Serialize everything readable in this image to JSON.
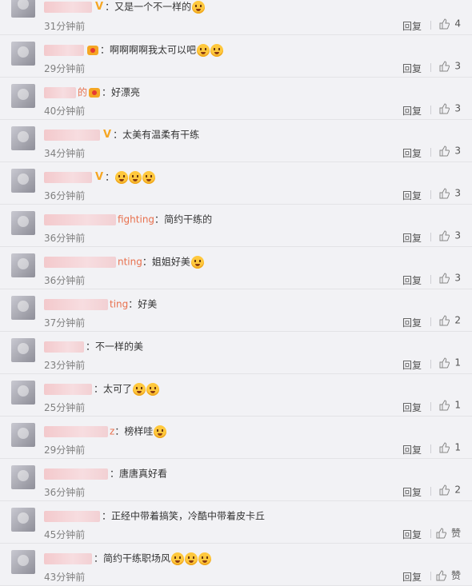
{
  "comments": [
    {
      "user_suffix": "",
      "text": "又是一个不一样的",
      "time": "31分钟前",
      "likes": "4",
      "emoji": 1,
      "badge": "v"
    },
    {
      "user_suffix": "",
      "text": "啊啊啊啊我太可以吧",
      "time": "29分钟前",
      "likes": "3",
      "emoji": 2,
      "badge": "crown"
    },
    {
      "user_suffix": "的",
      "text": "好漂亮",
      "time": "40分钟前",
      "likes": "3",
      "emoji": 0,
      "badge": "crown"
    },
    {
      "user_suffix": "",
      "text": "太美有温柔有干练",
      "time": "34分钟前",
      "likes": "3",
      "emoji": 0,
      "badge": "v"
    },
    {
      "user_suffix": "",
      "text": "",
      "time": "36分钟前",
      "likes": "3",
      "emoji": 3,
      "badge": "v"
    },
    {
      "user_suffix": "fighting",
      "text": "简约干练的",
      "time": "36分钟前",
      "likes": "3",
      "emoji": 0,
      "badge": ""
    },
    {
      "user_suffix": "nting",
      "text": "姐姐好美",
      "time": "36分钟前",
      "likes": "3",
      "emoji": 1,
      "badge": ""
    },
    {
      "user_suffix": "ting",
      "text": "好美",
      "time": "37分钟前",
      "likes": "2",
      "emoji": 0,
      "badge": ""
    },
    {
      "user_suffix": "",
      "text": "不一样的美",
      "time": "23分钟前",
      "likes": "1",
      "emoji": 0,
      "badge": ""
    },
    {
      "user_suffix": "",
      "text": "太可了",
      "time": "25分钟前",
      "likes": "1",
      "emoji": 2,
      "badge": ""
    },
    {
      "user_suffix": "z",
      "text": "榜样哇",
      "time": "29分钟前",
      "likes": "1",
      "emoji": 1,
      "badge": ""
    },
    {
      "user_suffix": "",
      "text": "唐唐真好看",
      "time": "36分钟前",
      "likes": "2",
      "emoji": 0,
      "badge": ""
    },
    {
      "user_suffix": "",
      "text": "正经中带着搞笑，冷酷中带着皮卡丘",
      "time": "45分钟前",
      "likes": "赞",
      "emoji": 0,
      "badge": ""
    },
    {
      "user_suffix": "",
      "text": "简约干练职场风",
      "time": "43分钟前",
      "likes": "赞",
      "emoji": 3,
      "badge": ""
    }
  ],
  "labels": {
    "reply": "回复",
    "colon": "："
  },
  "colors": {
    "username": "#e8704d",
    "badge_v": "#f5a623",
    "background": "#f2f2f5"
  }
}
